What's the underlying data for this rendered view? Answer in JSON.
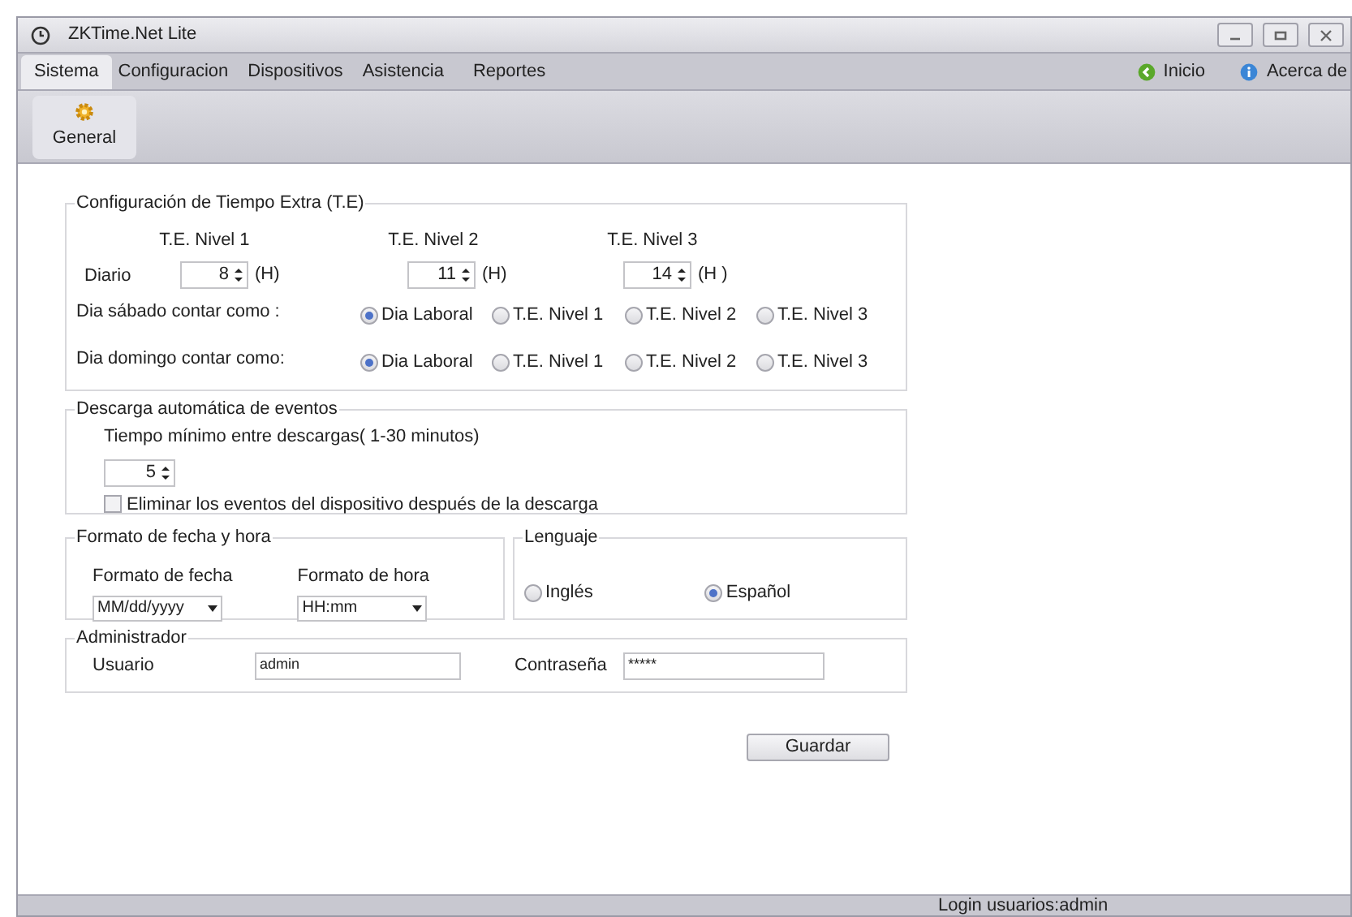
{
  "window": {
    "title": "ZKTime.Net Lite"
  },
  "menu": [
    {
      "label": "Sistema",
      "selected": true
    },
    {
      "label": "Configuracion",
      "selected": false
    },
    {
      "label": "Dispositivos",
      "selected": false
    },
    {
      "label": "Asistencia",
      "selected": false
    },
    {
      "label": "Reportes",
      "selected": false
    }
  ],
  "menu_right": [
    {
      "label": "Inicio",
      "kind": "home"
    },
    {
      "label": "Acerca de",
      "kind": "info"
    }
  ],
  "toolbar": [
    {
      "label": "General"
    }
  ],
  "overtime": {
    "legend": "Configuración de Tiempo Extra (T.E)",
    "levels": [
      "T.E. Nivel 1",
      "T.E. Nivel 2",
      "T.E. Nivel 3"
    ],
    "daily": {
      "label": "Diario",
      "values": [
        {
          "value": "8",
          "unit": "(H)"
        },
        {
          "value": "11",
          "unit": "(H)"
        },
        {
          "value": "14",
          "unit": "(H )"
        }
      ]
    },
    "rules": [
      {
        "label": "Dia sábado contar como :",
        "options": [
          {
            "label": "Dia Laboral",
            "selected": true
          },
          {
            "label": "T.E. Nivel 1",
            "selected": false
          },
          {
            "label": "T.E. Nivel 2",
            "selected": false
          },
          {
            "label": "T.E. Nivel 3",
            "selected": false
          }
        ]
      },
      {
        "label": "Dia domingo contar como:",
        "options": [
          {
            "label": "Dia Laboral",
            "selected": true
          },
          {
            "label": "T.E. Nivel 1",
            "selected": false
          },
          {
            "label": "T.E. Nivel 2",
            "selected": false
          },
          {
            "label": "T.E. Nivel 3",
            "selected": false
          }
        ]
      }
    ]
  },
  "download": {
    "legend": "Descarga automática de eventos",
    "interval_label": "Tiempo mínimo entre descargas( 1-30 minutos)",
    "interval_value": "5",
    "delete_events": {
      "label": "Eliminar los eventos del dispositivo después de la descarga",
      "checked": false
    }
  },
  "date_format": {
    "legend": "Formato de fecha y hora",
    "date_label": "Formato de fecha",
    "date_value": "MM/dd/yyyy",
    "time_label": "Formato de hora",
    "time_value": "HH:mm"
  },
  "language": {
    "legend": "Lenguaje",
    "options": [
      {
        "label": "Inglés",
        "selected": false
      },
      {
        "label": "Español",
        "selected": true
      }
    ]
  },
  "admin": {
    "legend": "Administrador",
    "user_label": "Usuario",
    "user_value": "admin",
    "password_label": "Contraseña",
    "password_value": "*****"
  },
  "save_button": "Guardar",
  "status_bar": "Login usuarios:admin"
}
